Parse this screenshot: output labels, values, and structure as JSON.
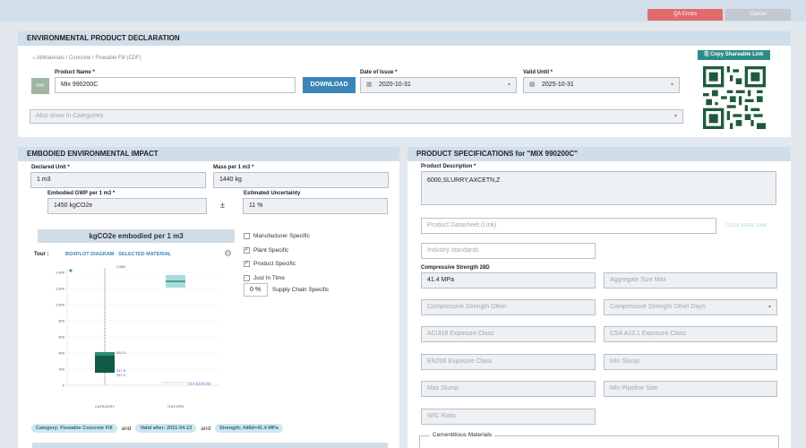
{
  "actions": {
    "qa_errors": "QA Errors",
    "cancel": "Cancel"
  },
  "epd": {
    "title": "ENVIRONMENTAL PRODUCT DECLARATION",
    "breadcrumb": "AllMaterials / Concrete / Flowable Fill (CDF)",
    "product_name_label": "Product Name *",
    "product_name": "Mix 990200C",
    "badge": "###",
    "download": "DOWNLOAD",
    "date_issue_label": "Date of Issue *",
    "date_issue": "2020-10-31",
    "valid_until_label": "Valid Until *",
    "valid_until": "2025-10-31",
    "categories_placeholder": "Also show in Categories",
    "share": "Copy Shareable Link"
  },
  "impact": {
    "title": "EMBODIED ENVIRONMENTAL IMPACT",
    "declared_unit_label": "Declared Unit *",
    "declared_unit": "1 m3",
    "mass_label": "Mass per 1 m3 *",
    "mass": "1440 kg",
    "gwp_label": "Embodied GWP per 1 m3 *",
    "gwp": "1450 kgCO2e",
    "pm": "±",
    "uncert_label": "Estimated Uncertainty",
    "uncert": "11 %",
    "chart_title": "kgCO2e embodied per 1 m3",
    "tour": "Tour :",
    "diagram_label": "BOXPLOT DIAGRAM · SELECTED MATERIAL",
    "checks": [
      {
        "label": "Manufacturer Specific",
        "checked": false
      },
      {
        "label": "Plant Specific",
        "checked": true
      },
      {
        "label": "Product Specific",
        "checked": true
      },
      {
        "label": "Just In Time",
        "checked": false
      }
    ],
    "supply_chain_value": "0 %",
    "supply_chain_label": "Supply Chain Specific",
    "chips": [
      "Category: Flowable Concrete Fill",
      "and",
      "Valid after: 2021-04-13",
      "and",
      "Strength: #d8d=41.4 MPa"
    ]
  },
  "chart_data": {
    "type": "boxplot",
    "y_ticks": [
      "1,400",
      "1,200",
      "1,000",
      "800",
      "600",
      "400",
      "200",
      "0"
    ],
    "ylim": [
      0,
      1500
    ],
    "categories": [
      "CATEGORY",
      "THIS EPD"
    ],
    "annotations": {
      "top": "1,580",
      "mid": "510.3",
      "low1": "347.8",
      "low2": "267.0"
    },
    "this_epd_value": 1450,
    "ref_label": "2021 BASELINE"
  },
  "specs": {
    "title": "PRODUCT SPECIFICATIONS for \"MIX 990200C\"",
    "desc_label": "Product Description *",
    "desc": "6000,SLURRY,AXCETN,Z",
    "datasheet_placeholder": "Product Datasheet (Link)",
    "click_here": "CLICK HERE LINK",
    "standards_placeholder": "Industry standards",
    "strength_label": "Compressive Strength 28D",
    "strength": "41.4 MPa",
    "agg_size": "Aggregate Size Max",
    "comp_other": "Compressive Strength Other",
    "comp_other_days": "Compressive Strength Other Days",
    "aci_exposure": "ACI318 Exposure Class",
    "csa_exposure": "CSA A23.1 Exposure Class",
    "en_exposure": "EN206 Exposure Class",
    "min_slump": "Min Slump",
    "max_slump": "Max Slump",
    "min_pipeline": "Min Pipeline Size",
    "wc_ratio": "W/C Ratio",
    "cementitious": "Cementitious Materials"
  }
}
